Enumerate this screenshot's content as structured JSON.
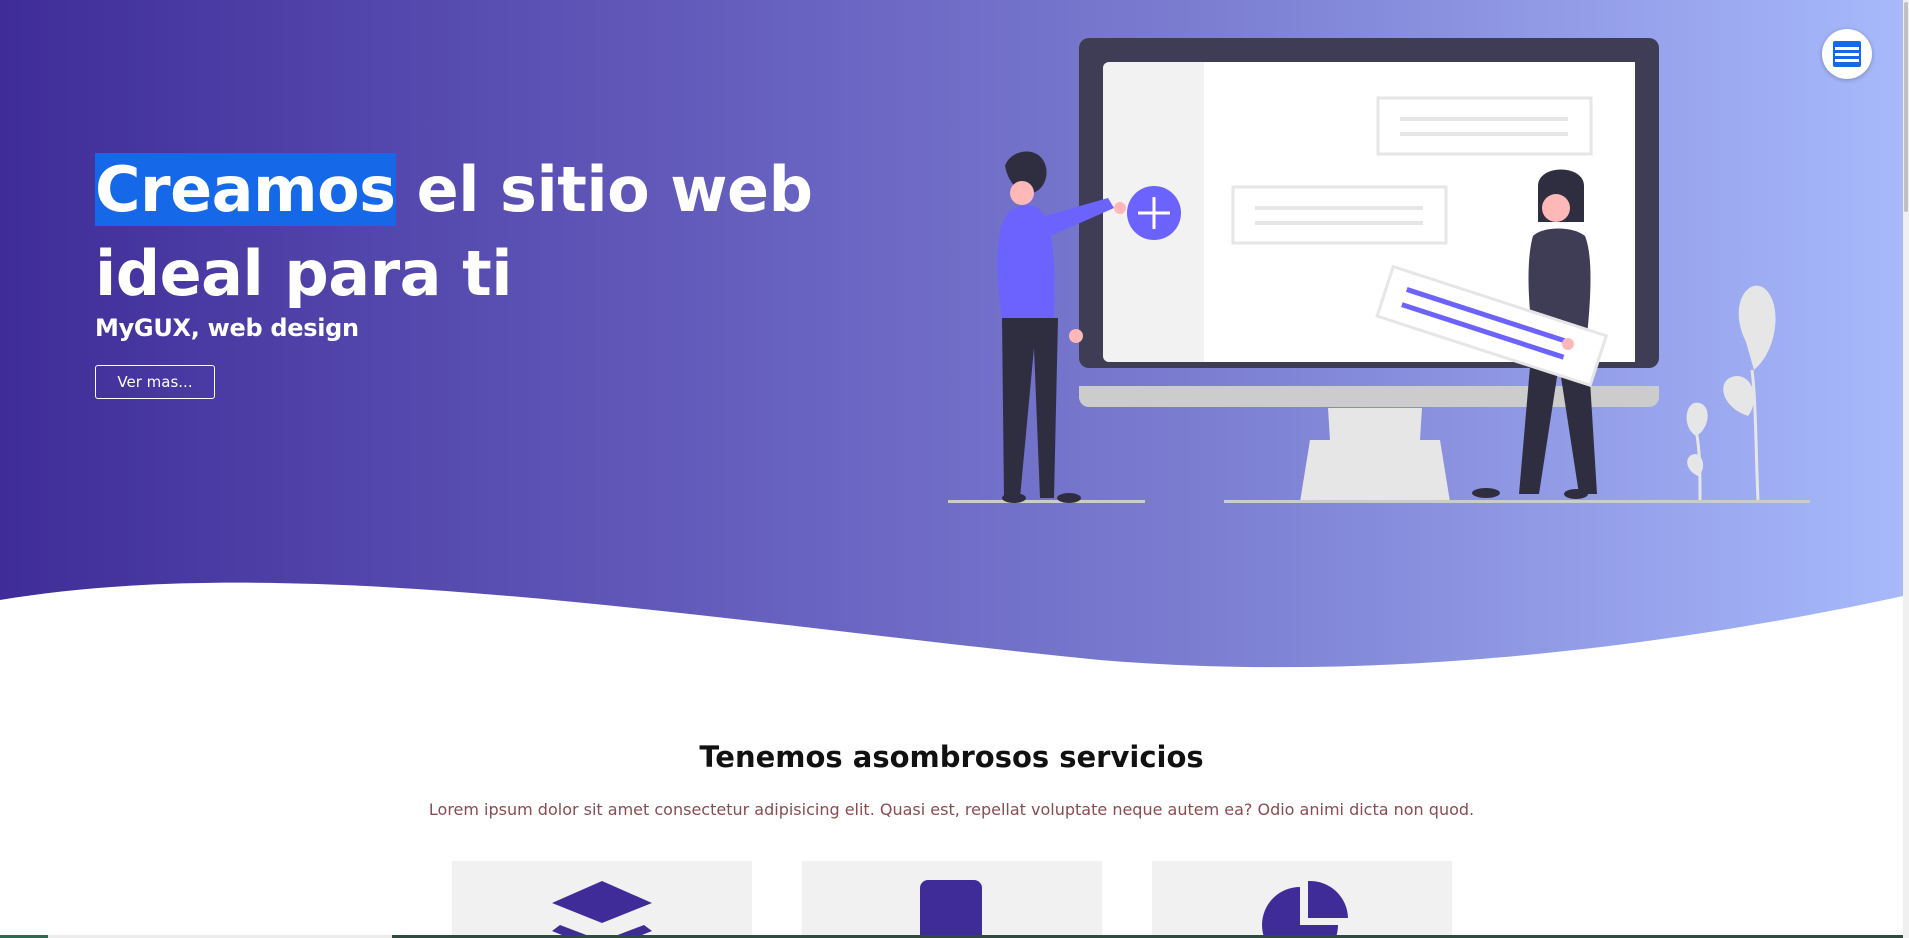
{
  "hero": {
    "title_highlight": "Creamos",
    "title_rest": " el sitio web ideal para ti",
    "subtitle": "MyGUX, web design",
    "button_label": "Ver mas..."
  },
  "services": {
    "title": "Tenemos asombrosos servicios",
    "description": "Lorem ipsum dolor sit amet consectetur adipisicing elit. Quasi est, repellat voluptate neque autem ea? Odio animi dicta non quod.",
    "cards": [
      {
        "icon": "layers-icon"
      },
      {
        "icon": "mobile-icon"
      },
      {
        "icon": "pie-chart-icon"
      }
    ]
  },
  "menu": {
    "icon": "hamburger-menu-icon"
  },
  "colors": {
    "gradient_start": "#3f2c98",
    "gradient_end": "#a7b9fb",
    "highlight": "#1569e8",
    "icon_purple": "#3f2c98",
    "accent": "#6c63ff"
  }
}
